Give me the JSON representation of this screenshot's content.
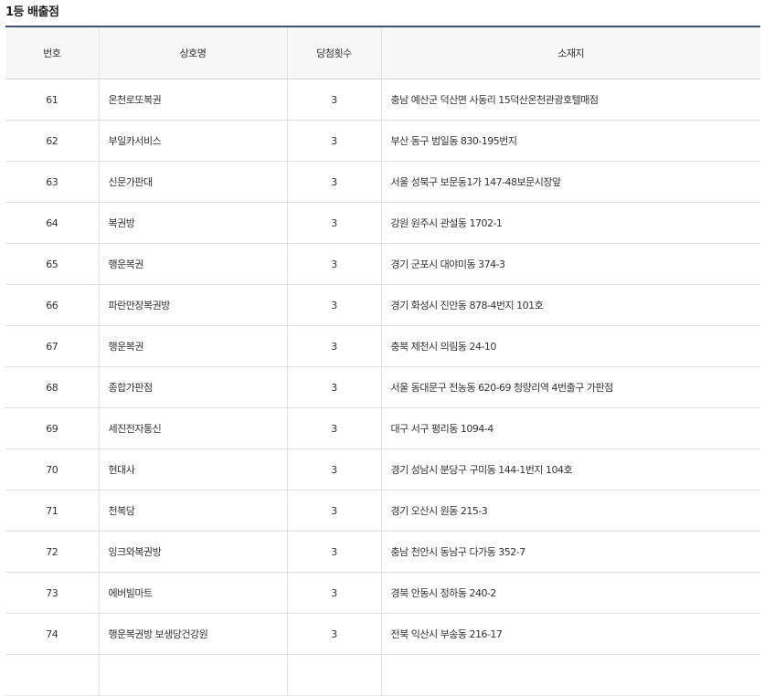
{
  "section": {
    "title": "1등 배출점"
  },
  "table": {
    "headers": {
      "num": "번호",
      "name": "상호명",
      "count": "당첨횟수",
      "addr": "소재지"
    },
    "rows": [
      {
        "num": "61",
        "name": "온천로또복권",
        "count": "3",
        "addr": "충남 예산군 덕산면 사동리 15덕산온천관광호텔매점"
      },
      {
        "num": "62",
        "name": "부일카서비스",
        "count": "3",
        "addr": "부산 동구 범일동 830-195번지"
      },
      {
        "num": "63",
        "name": "신문가판대",
        "count": "3",
        "addr": "서울 성북구 보문동1가 147-48보문시장앞"
      },
      {
        "num": "64",
        "name": "복권방",
        "count": "3",
        "addr": "강원 원주시 관설동 1702-1"
      },
      {
        "num": "65",
        "name": "행운복권",
        "count": "3",
        "addr": "경기 군포시 대야미동 374-3"
      },
      {
        "num": "66",
        "name": "파란만장복권방",
        "count": "3",
        "addr": "경기 화성시 진안동 878-4번지 101호"
      },
      {
        "num": "67",
        "name": "행운복권",
        "count": "3",
        "addr": "충북 제천시 의림동 24-10"
      },
      {
        "num": "68",
        "name": "종합가판점",
        "count": "3",
        "addr": "서울 동대문구 전농동 620-69 청량리역 4번출구 가판점"
      },
      {
        "num": "69",
        "name": "세진전자통신",
        "count": "3",
        "addr": "대구 서구 평리동 1094-4"
      },
      {
        "num": "70",
        "name": "현대사",
        "count": "3",
        "addr": "경기 성남시 분당구 구미동 144-1번지 104호"
      },
      {
        "num": "71",
        "name": "천복당",
        "count": "3",
        "addr": "경기 오산시 원동 215-3"
      },
      {
        "num": "72",
        "name": "잉크와복권방",
        "count": "3",
        "addr": "충남 천안시 동남구 다가동 352-7"
      },
      {
        "num": "73",
        "name": "에버빌마트",
        "count": "3",
        "addr": "경북 안동시 정하동 240-2"
      },
      {
        "num": "74",
        "name": "행운복권방 보생당건강원",
        "count": "3",
        "addr": "전북 익산시 부송동 216-17"
      },
      {
        "num": "",
        "name": "",
        "count": "",
        "addr": ""
      }
    ]
  }
}
